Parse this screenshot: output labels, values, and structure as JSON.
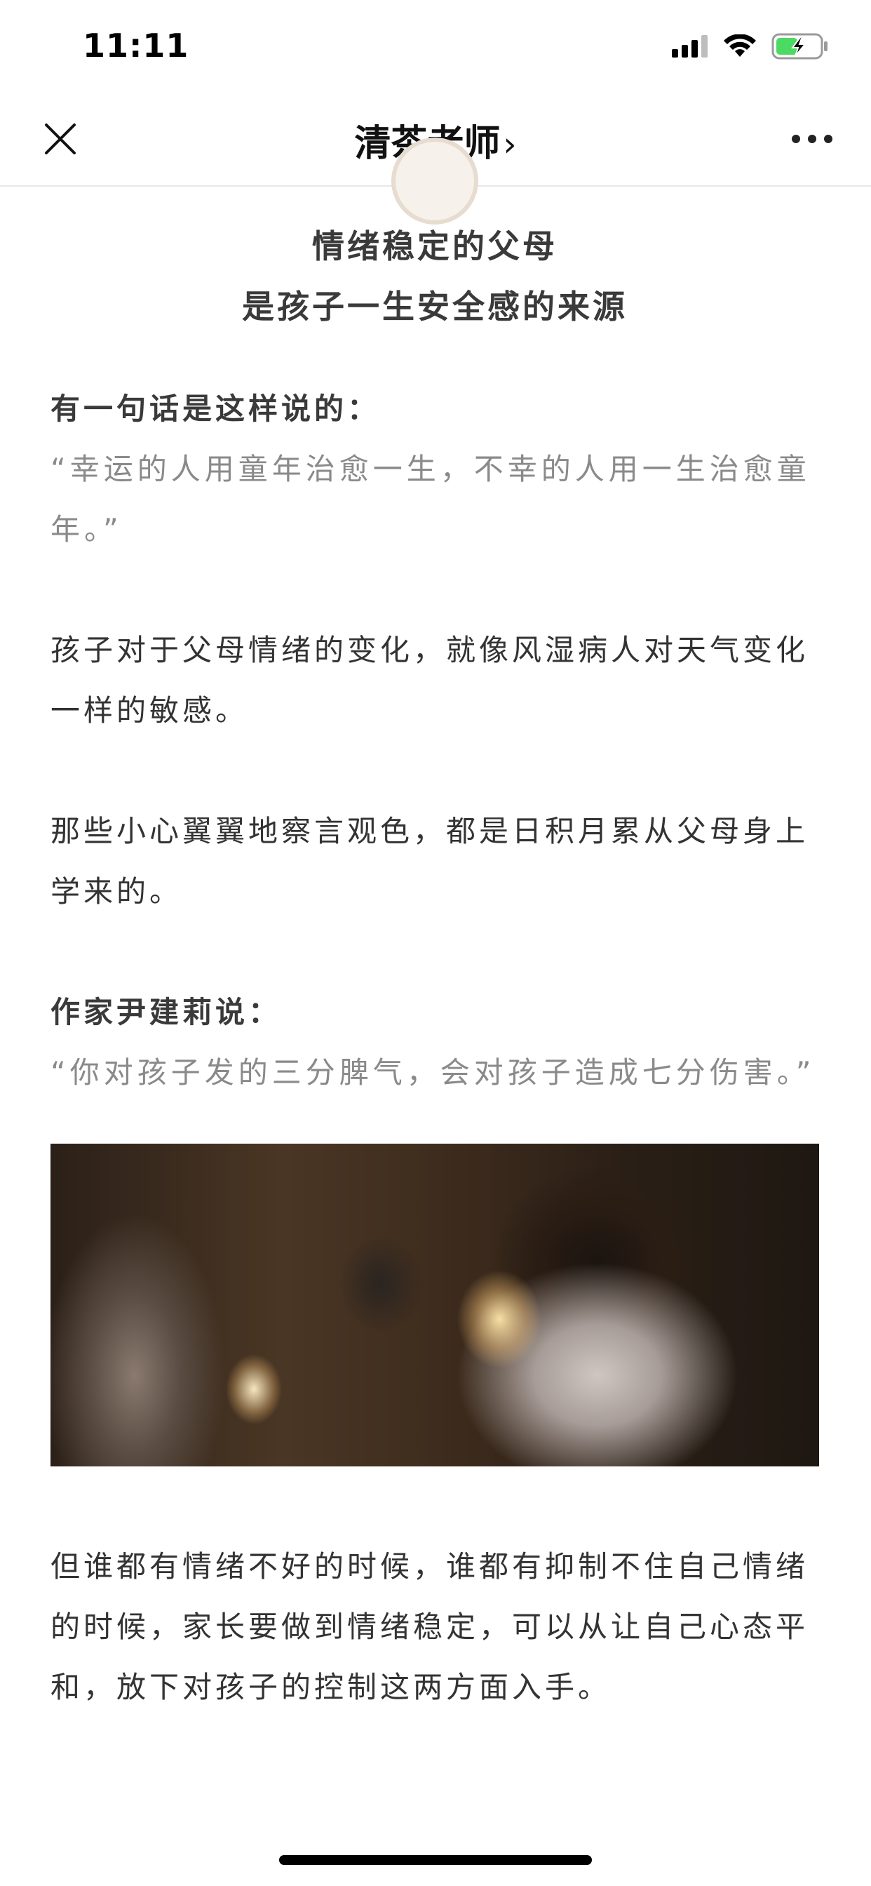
{
  "status_bar": {
    "time": "11:11",
    "icons": [
      "signal-icon",
      "wifi-icon",
      "battery-charging-icon"
    ]
  },
  "nav": {
    "title": "清茶老师",
    "chevron": "›",
    "icons": [
      "close-icon",
      "more-icon"
    ]
  },
  "article": {
    "heading_line1": "情绪稳定的父母",
    "heading_line2": "是孩子一生安全感的来源",
    "p1_lead": "有一句话是这样说的：",
    "p1_quote": "“幸运的人用童年治愈一生，不幸的人用一生治愈童年。”",
    "p2": "孩子对于父母情绪的变化，就像风湿病人对天气变化一样的敏感。",
    "p3": "那些小心翼翼地察言观色，都是日积月累从父母身上学来的。",
    "p4_lead": "作家尹建莉说：",
    "p4_quote": "“你对孩子发的三分脾气，会对孩子造成七分伤害。”",
    "p5": "但谁都有情绪不好的时候，谁都有抑制不住自己情绪的时候，家长要做到情绪稳定，可以从让自己心态平和，放下对孩子的控制这两方面入手。"
  },
  "colors": {
    "text": "#333333",
    "quote": "#8a8a8a",
    "heading": "#3a3a3a",
    "divider": "#e8e8e8"
  }
}
